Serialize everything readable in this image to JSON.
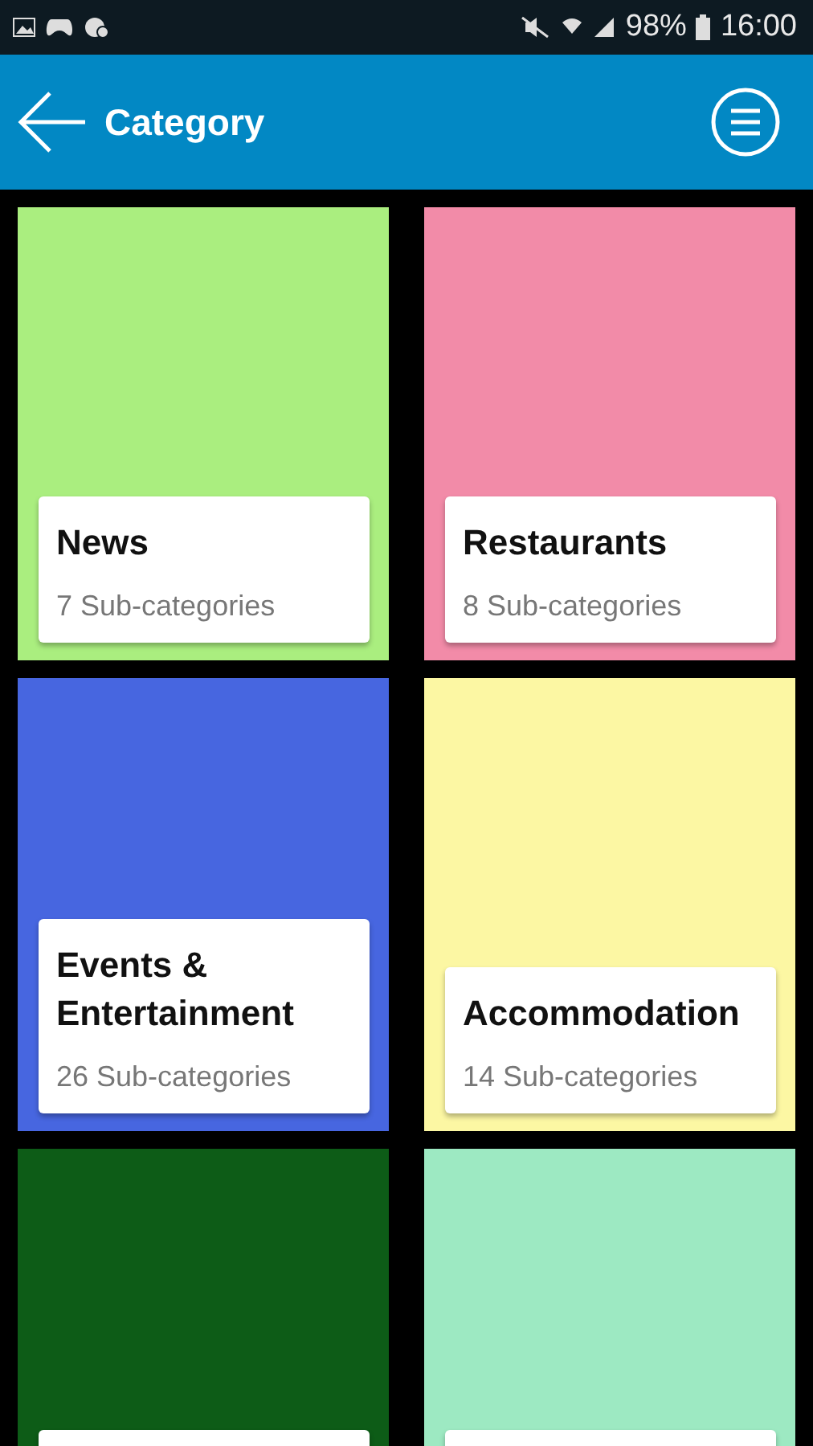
{
  "status_bar": {
    "battery": "98%",
    "time": "16:00"
  },
  "header": {
    "title": "Category"
  },
  "tiles": [
    {
      "title": "News",
      "subtitle": "7 Sub-categories",
      "color": "#aaee7f"
    },
    {
      "title": "Restaurants",
      "subtitle": "8 Sub-categories",
      "color": "#f28ba8"
    },
    {
      "title": "Events & Entertainment",
      "subtitle": "26 Sub-categories",
      "color": "#4766e0"
    },
    {
      "title": "Accommodation",
      "subtitle": "14 Sub-categories",
      "color": "#fcf7a3"
    },
    {
      "color": "#0d5c17"
    },
    {
      "color": "#9de9c2"
    }
  ]
}
